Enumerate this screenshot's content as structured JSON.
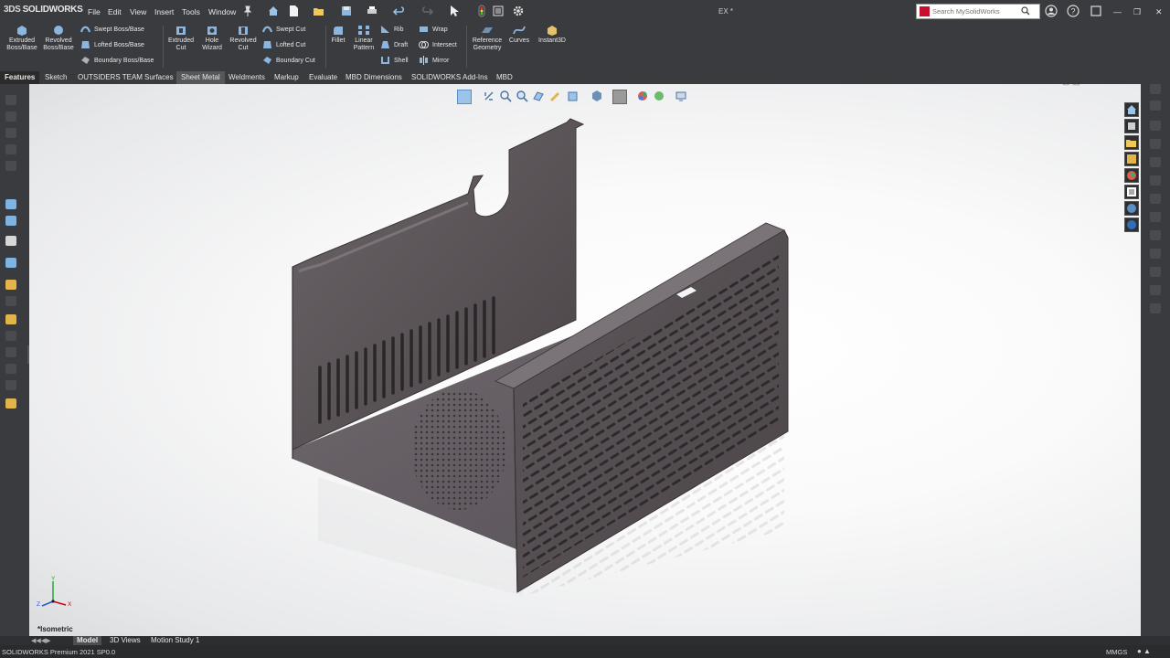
{
  "app": {
    "logo_ds": "3DS",
    "logo_text": "SOLIDWORKS",
    "document_title": "EX *",
    "search_placeholder": "Search MySolidWorks"
  },
  "menus": [
    "File",
    "Edit",
    "View",
    "Insert",
    "Tools",
    "Window"
  ],
  "commands": {
    "extruded_boss": "Extruded Boss/Base",
    "revolved_boss": "Revolved Boss/Base",
    "swept_boss": "Swept Boss/Base",
    "lofted_boss": "Lofted Boss/Base",
    "boundary_boss": "Boundary Boss/Base",
    "extruded_cut": "Extruded Cut",
    "hole_wizard": "Hole Wizard",
    "revolved_cut": "Revolved Cut",
    "swept_cut": "Swept Cut",
    "lofted_cut": "Lofted Cut",
    "boundary_cut": "Boundary Cut",
    "fillet": "Fillet",
    "linear_pattern": "Linear Pattern",
    "rib": "Rib",
    "draft": "Draft",
    "shell": "Shell",
    "wrap": "Wrap",
    "intersect": "Intersect",
    "mirror": "Mirror",
    "reference_geometry": "Reference Geometry",
    "curves": "Curves",
    "instant3d": "Instant3D"
  },
  "tabs": [
    "Features",
    "Sketch",
    "OUTSIDERS TEAM",
    "Surfaces",
    "Sheet Metal",
    "Weldments",
    "Markup",
    "Evaluate",
    "MBD Dimensions",
    "SOLIDWORKS Add-Ins",
    "MBD"
  ],
  "active_tab": "Features",
  "viewport": {
    "view_name": "*Isometric",
    "triad": {
      "x": "X",
      "y": "Y",
      "z": "Z"
    }
  },
  "bottom_tabs": [
    "Model",
    "3D Views",
    "Motion Study 1"
  ],
  "status": {
    "left": "SOLIDWORKS Premium 2021 SP0.0",
    "units": "MMGS"
  },
  "colors": {
    "chrome": "#3a3b3e",
    "part": "#5d5659",
    "accent": "#d0021b"
  }
}
